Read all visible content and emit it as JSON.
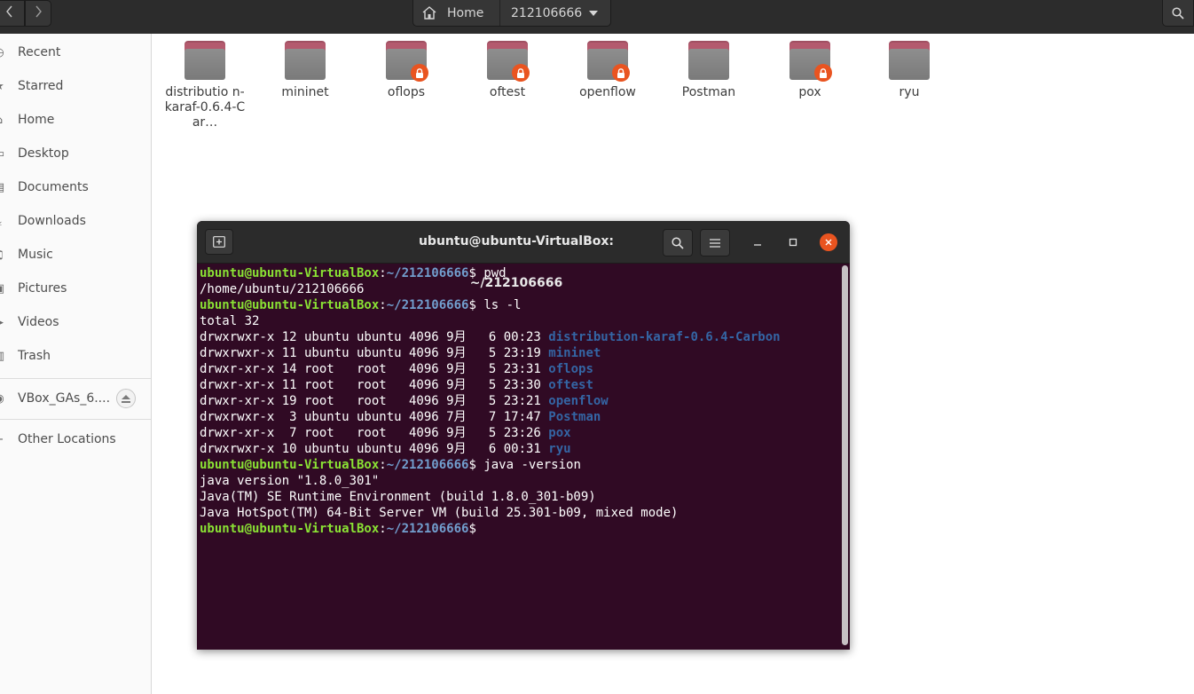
{
  "headerbar": {
    "path": [
      {
        "label": "Home",
        "icon": "home-icon"
      },
      {
        "label": "212106666"
      }
    ]
  },
  "sidebar": {
    "items": [
      {
        "label": "Recent",
        "icon": "clock-icon"
      },
      {
        "label": "Starred",
        "icon": "star-icon"
      },
      {
        "label": "Home",
        "icon": "home-icon"
      },
      {
        "label": "Desktop",
        "icon": "desktop-icon"
      },
      {
        "label": "Documents",
        "icon": "document-icon"
      },
      {
        "label": "Downloads",
        "icon": "download-icon"
      },
      {
        "label": "Music",
        "icon": "music-icon"
      },
      {
        "label": "Pictures",
        "icon": "picture-icon"
      },
      {
        "label": "Videos",
        "icon": "video-icon"
      },
      {
        "label": "Trash",
        "icon": "trash-icon"
      }
    ],
    "device": {
      "label": "VBox_GAs_6....",
      "icon": "disc-icon"
    },
    "other": {
      "label": "Other Locations",
      "icon": "plus-icon"
    }
  },
  "files": [
    {
      "name": "distributio n-karaf-0.6.4-Car…",
      "locked": false
    },
    {
      "name": "mininet",
      "locked": false
    },
    {
      "name": "oflops",
      "locked": true
    },
    {
      "name": "oftest",
      "locked": true
    },
    {
      "name": "openflow",
      "locked": true
    },
    {
      "name": "Postman",
      "locked": false
    },
    {
      "name": "pox",
      "locked": true
    },
    {
      "name": "ryu",
      "locked": false
    }
  ],
  "terminal": {
    "title": "ubuntu@ubuntu-VirtualBox: ~/212106666",
    "prompt_user": "ubuntu@ubuntu-VirtualBox",
    "prompt_path": "~/212106666",
    "lines": [
      {
        "type": "cmd",
        "text": " pwd"
      },
      {
        "type": "out",
        "text": "/home/ubuntu/212106666"
      },
      {
        "type": "cmd",
        "text": " ls -l"
      },
      {
        "type": "out",
        "text": "total 32"
      },
      {
        "type": "ls",
        "meta": "drwxrwxr-x 12 ubuntu ubuntu 4096 9月   6 00:23 ",
        "name": "distribution-karaf-0.6.4-Carbon"
      },
      {
        "type": "ls",
        "meta": "drwxrwxr-x 11 ubuntu ubuntu 4096 9月   5 23:19 ",
        "name": "mininet"
      },
      {
        "type": "ls",
        "meta": "drwxr-xr-x 14 root   root   4096 9月   5 23:31 ",
        "name": "oflops"
      },
      {
        "type": "ls",
        "meta": "drwxr-xr-x 11 root   root   4096 9月   5 23:30 ",
        "name": "oftest"
      },
      {
        "type": "ls",
        "meta": "drwxr-xr-x 19 root   root   4096 9月   5 23:21 ",
        "name": "openflow"
      },
      {
        "type": "ls",
        "meta": "drwxrwxr-x  3 ubuntu ubuntu 4096 7月   7 17:47 ",
        "name": "Postman"
      },
      {
        "type": "ls",
        "meta": "drwxr-xr-x  7 root   root   4096 9月   5 23:26 ",
        "name": "pox"
      },
      {
        "type": "ls",
        "meta": "drwxrwxr-x 10 ubuntu ubuntu 4096 9月   6 00:31 ",
        "name": "ryu"
      },
      {
        "type": "cmd",
        "text": " java -version"
      },
      {
        "type": "out",
        "text": "java version \"1.8.0_301\""
      },
      {
        "type": "out",
        "text": "Java(TM) SE Runtime Environment (build 1.8.0_301-b09)"
      },
      {
        "type": "out",
        "text": "Java HotSpot(TM) 64-Bit Server VM (build 25.301-b09, mixed mode)"
      },
      {
        "type": "cmd",
        "text": ""
      }
    ]
  },
  "colors": {
    "terminal_bg": "#300a24",
    "prompt_user": "#8ae234",
    "prompt_path": "#729fcf",
    "dir": "#3465a4",
    "accent": "#e95420"
  }
}
